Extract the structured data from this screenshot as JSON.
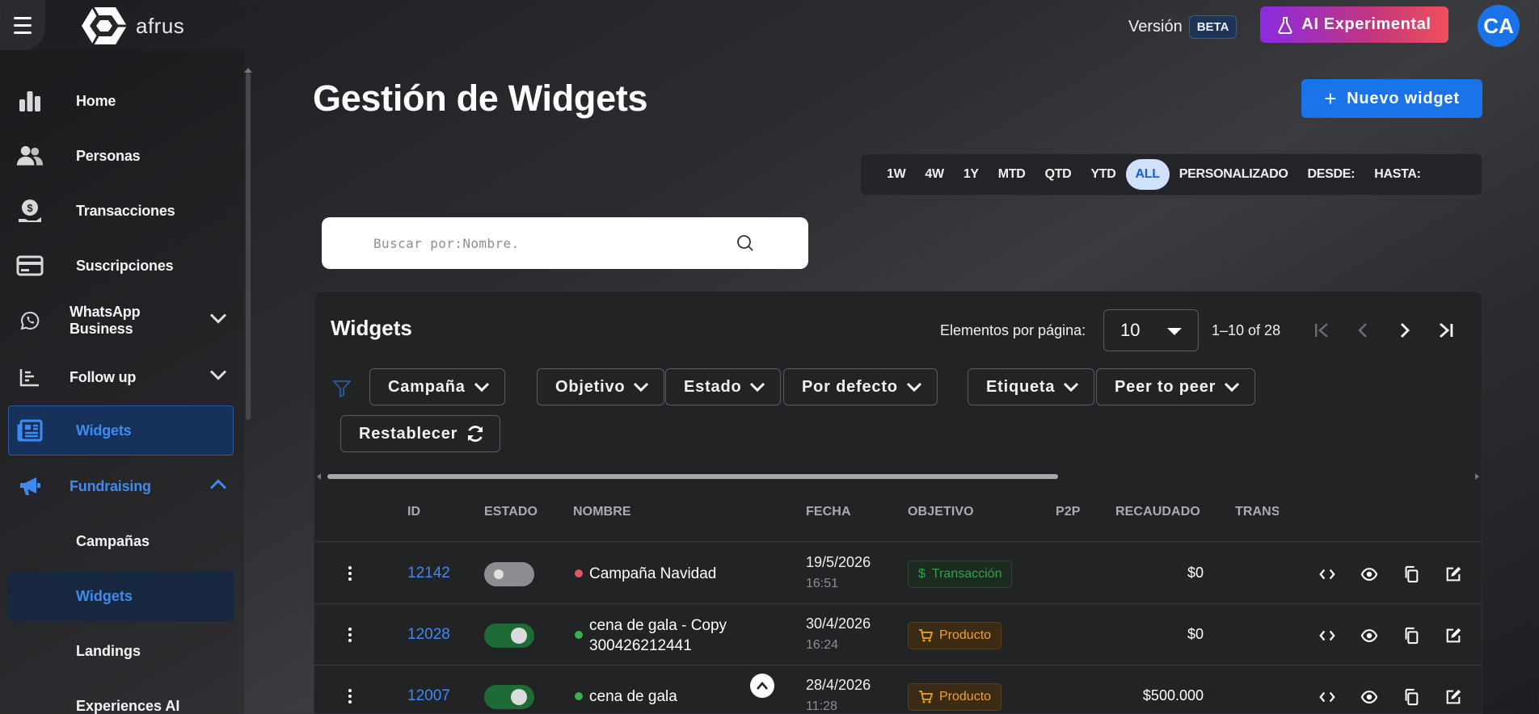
{
  "app": {
    "name": "afrus"
  },
  "header": {
    "version_label": "Versión",
    "beta_badge": "BETA",
    "ai_button": "AI Experimental",
    "avatar_initials": "CA"
  },
  "sidebar": {
    "items": [
      {
        "label": "Home",
        "icon": "bar-chart-icon"
      },
      {
        "label": "Personas",
        "icon": "people-icon"
      },
      {
        "label": "Transacciones",
        "icon": "money-hand-icon"
      },
      {
        "label": "Suscripciones",
        "icon": "credit-card-icon"
      },
      {
        "label": "WhatsApp Business",
        "icon": "whatsapp-icon"
      },
      {
        "label": "Follow up",
        "icon": "line-chart-icon"
      },
      {
        "label": "Widgets",
        "icon": "newspaper-icon"
      },
      {
        "label": "Fundraising",
        "icon": "megaphone-icon"
      }
    ],
    "sub_items": [
      {
        "label": "Campañas"
      },
      {
        "label": "Widgets"
      },
      {
        "label": "Landings"
      },
      {
        "label": "Experiences AI"
      }
    ]
  },
  "main": {
    "title": "Gestión de Widgets",
    "new_button": "Nuevo widget",
    "range_options": [
      "1W",
      "4W",
      "1Y",
      "MTD",
      "QTD",
      "YTD",
      "ALL",
      "PERSONALIZADO",
      "DESDE:",
      "HASTA:"
    ],
    "range_selected": "ALL",
    "search_placeholder": "Buscar por:Nombre."
  },
  "card": {
    "title": "Widgets",
    "per_page_label": "Elementos por página:",
    "per_page_value": "10",
    "range_text": "1–10 of 28",
    "filters": [
      "Campaña",
      "Objetivo",
      "Estado",
      "Por defecto",
      "Etiqueta",
      "Peer to peer"
    ],
    "reset_label": "Restablecer",
    "columns": [
      "ID",
      "ESTADO",
      "NOMBRE",
      "FECHA",
      "OBJETIVO",
      "P2P",
      "RECAUDADO",
      "TRANS"
    ],
    "rows": [
      {
        "id": "12142",
        "active": false,
        "status_color": "#e0566a",
        "name": "Campaña Navidad",
        "date": "19/5/2026",
        "time": "16:51",
        "objective": "Transacción",
        "objective_type": "tx",
        "raised": "$0"
      },
      {
        "id": "12028",
        "active": true,
        "status_color": "#37b24d",
        "name": "cena de gala - Copy 300426212441",
        "date": "30/4/2026",
        "time": "16:24",
        "objective": "Producto",
        "objective_type": "pr",
        "raised": "$0"
      },
      {
        "id": "12007",
        "active": true,
        "status_color": "#37b24d",
        "name": "cena de gala",
        "date": "28/4/2026",
        "time": "11:28",
        "objective": "Producto",
        "objective_type": "pr",
        "raised": "$500.000"
      }
    ]
  },
  "colors": {
    "accent": "#1a73e8",
    "link": "#3d8bf2",
    "success": "#2fa44c",
    "warning": "#f3a128"
  }
}
